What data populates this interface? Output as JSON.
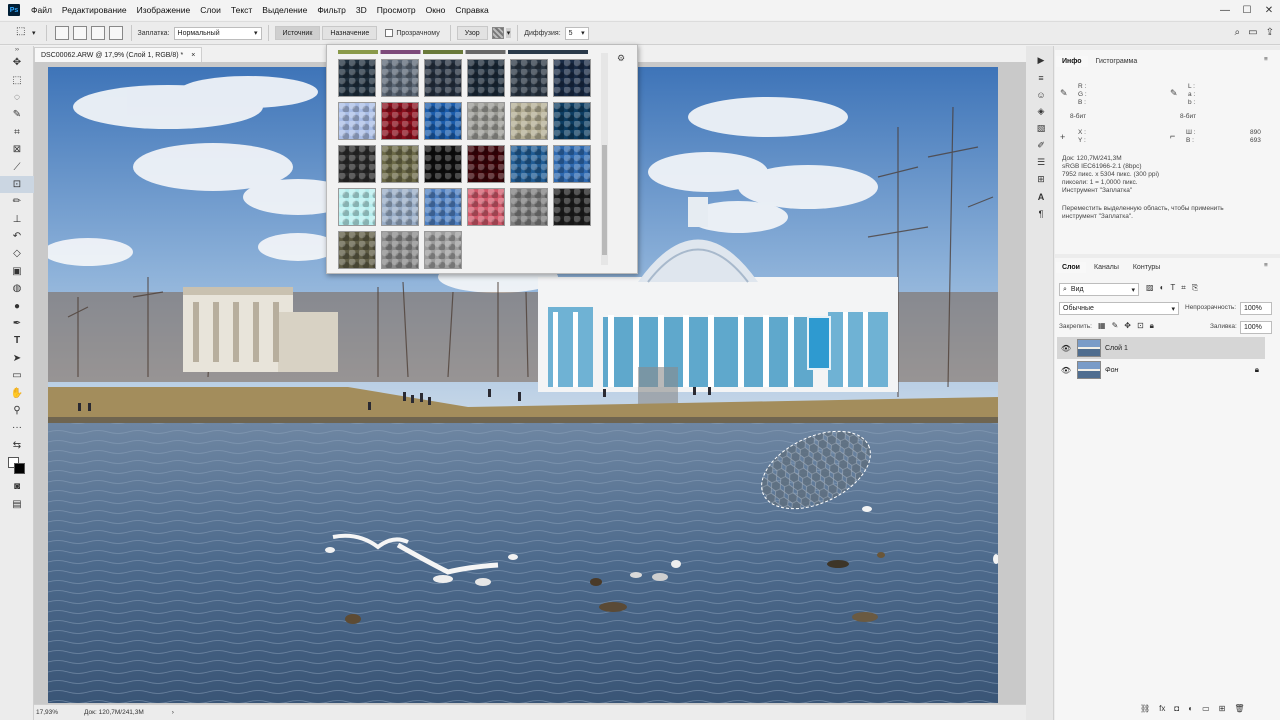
{
  "menubar": {
    "logo": "Ps",
    "items": [
      "Файл",
      "Редактирование",
      "Изображение",
      "Слои",
      "Текст",
      "Выделение",
      "Фильтр",
      "3D",
      "Просмотр",
      "Окно",
      "Справка"
    ]
  },
  "options": {
    "patch_label": "Заплатка:",
    "patch_mode": "Нормальный",
    "source_btn": "Источник",
    "dest_btn": "Назначение",
    "transparent_label": "Прозрачному",
    "pattern_btn": "Узор",
    "diffusion_label": "Диффузия:",
    "diffusion_value": "5"
  },
  "document": {
    "tab_title": "DSC00062.ARW @ 17,9% (Слой 1, RGB/8) *",
    "close": "×"
  },
  "status": {
    "zoom": "17,93%",
    "doc_info": "Док: 120,7M/241,3M",
    "arrow": "›"
  },
  "info_panel": {
    "tab_info": "Инфо",
    "tab_histogram": "Гистограмма",
    "rgb_r": "R :",
    "rgb_g": "G :",
    "rgb_b": "B :",
    "lab_l": "L :",
    "lab_a": "a :",
    "lab_b": "b :",
    "bit1": "8-бит",
    "bit2": "8-бит",
    "x": "X :",
    "y": "Y :",
    "w": "Ш :",
    "h": "В :",
    "w_val": "890",
    "h_val": "693",
    "doc": "Док: 120,7M/241,3M",
    "profile": "sRGB IEC61966-2.1 (8bpc)",
    "pixels": "7952 пикс. x 5304 пикс. (300 ppi)",
    "ratio": "пиксели: 1 = 1,0000 пикс.",
    "tool": "Инструмент \"Заплатка\"",
    "hint1": "Переместить выделенную область, чтобы применить",
    "hint2": "инструмент \"Заплатка\"."
  },
  "layers_panel": {
    "tab_layers": "Слои",
    "tab_channels": "Каналы",
    "tab_paths": "Контуры",
    "filter_kind": "Вид",
    "blend": "Обычные",
    "opacity_label": "Непрозрачность:",
    "opacity_value": "100%",
    "lock_label": "Закрепить:",
    "fill_label": "Заливка:",
    "fill_value": "100%",
    "layers": [
      {
        "name": "Слой 1",
        "selected": true
      },
      {
        "name": "Фон",
        "selected": false
      }
    ]
  },
  "pattern_swatches": [
    [
      "#1e2e3c",
      "#5b6775",
      "#25303f",
      "#1b2a38",
      "#2a3643",
      "#182a44"
    ],
    [
      "#a9bde6",
      "#8a0f1c",
      "#1a5cab",
      "#9b9b95",
      "#b3ad93",
      "#0d3d62"
    ],
    [
      "#2b2b2b",
      "#6c6a48",
      "#0e0e0e",
      "#3b0308",
      "#205c94",
      "#2e69b0"
    ],
    [
      "#b6eeee",
      "#98acc6",
      "#4e7fc0",
      "#d2596b",
      "#7d7d7d",
      "#1d1d1d"
    ],
    [
      "#5f5c44",
      "#8a8a8a",
      "#9d9d9d"
    ]
  ],
  "colors": {
    "sky_top": "#3f76b9",
    "water": "#4b6889",
    "pavilion": "#5fa8cc",
    "accent": "#2f9bd6"
  }
}
